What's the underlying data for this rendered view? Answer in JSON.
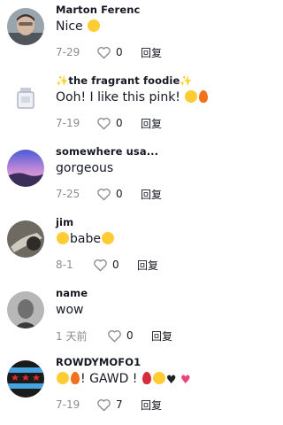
{
  "comments": [
    {
      "username": "Marton Ferenc",
      "text": "Nice ",
      "date": "7-29",
      "likes": "0",
      "reply": "回复"
    },
    {
      "username": "✨the fragrant foodie✨",
      "text": "Ooh! I like this pink! ",
      "date": "7-19",
      "likes": "0",
      "reply": "回复"
    },
    {
      "username": "somewhere usa...",
      "text": "gorgeous",
      "date": "7-25",
      "likes": "0",
      "reply": "回复"
    },
    {
      "username": "jim",
      "text": "babe",
      "date": "8-1",
      "likes": "0",
      "reply": "回复"
    },
    {
      "username": "name",
      "text": "wow",
      "date": "1 天前",
      "likes": "0",
      "reply": "回复"
    },
    {
      "username": "ROWDYMOFO1",
      "text": "! GAWD ! ",
      "date": "7-19",
      "likes": "7",
      "reply": "回复"
    }
  ],
  "icons": {
    "like": "heart-outline-icon"
  },
  "colors": {
    "meta": "#8a8b91",
    "text": "#161823",
    "background": "#ffffff"
  }
}
